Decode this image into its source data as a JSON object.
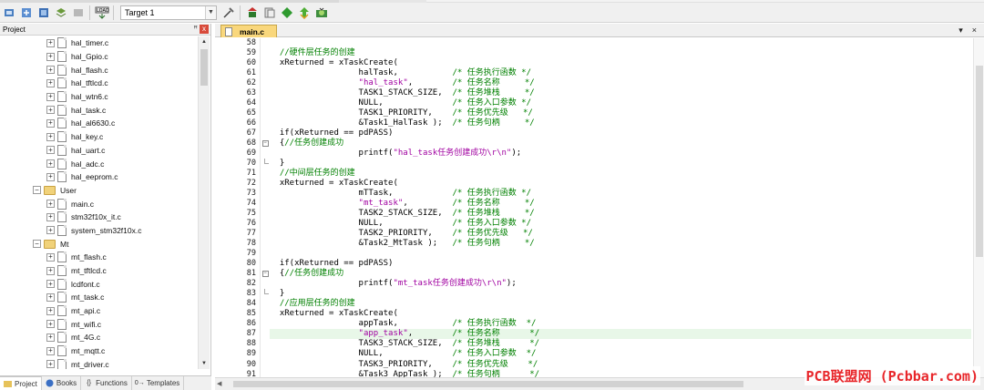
{
  "toolbar": {
    "target": "Target 1",
    "icons": [
      "build-icon",
      "rebuild-icon",
      "batch-build-icon",
      "download-icon",
      "translate-icon",
      "load-icon",
      "options-icon",
      "manage-icon",
      "pack-icon",
      "select-icon",
      "settings-icon",
      "green-diamond-icon",
      "debug-icon"
    ]
  },
  "project_panel": {
    "title": "Project",
    "pin": "ꟸ",
    "close": "x",
    "tree": [
      {
        "type": "file",
        "label": "hal_timer.c"
      },
      {
        "type": "file",
        "label": "hal_Gpio.c"
      },
      {
        "type": "file",
        "label": "hal_flash.c"
      },
      {
        "type": "file",
        "label": "hal_tftlcd.c"
      },
      {
        "type": "file",
        "label": "hal_wtn6.c"
      },
      {
        "type": "file",
        "label": "hal_task.c"
      },
      {
        "type": "file",
        "label": "hal_al6630.c"
      },
      {
        "type": "file",
        "label": "hal_key.c"
      },
      {
        "type": "file",
        "label": "hal_uart.c"
      },
      {
        "type": "file",
        "label": "hal_adc.c"
      },
      {
        "type": "file",
        "label": "hal_eeprom.c"
      },
      {
        "type": "folder",
        "label": "User"
      },
      {
        "type": "file",
        "label": "main.c"
      },
      {
        "type": "file",
        "label": "stm32f10x_it.c"
      },
      {
        "type": "file",
        "label": "system_stm32f10x.c"
      },
      {
        "type": "folder",
        "label": "Mt"
      },
      {
        "type": "file",
        "label": "mt_flash.c"
      },
      {
        "type": "file",
        "label": "mt_tftlcd.c"
      },
      {
        "type": "file",
        "label": "lcdfont.c"
      },
      {
        "type": "file",
        "label": "mt_task.c"
      },
      {
        "type": "file",
        "label": "mt_api.c"
      },
      {
        "type": "file",
        "label": "mt_wifi.c"
      },
      {
        "type": "file",
        "label": "mt_4G.c"
      },
      {
        "type": "file",
        "label": "mt_mqtt.c"
      },
      {
        "type": "file",
        "label": "mt_driver.c"
      }
    ],
    "tabs": [
      {
        "label": "Project",
        "icon": "project-icon"
      },
      {
        "label": "Books",
        "icon": "books-icon"
      },
      {
        "label": "Functions",
        "icon": "functions-icon"
      },
      {
        "label": "Templates",
        "icon": "templates-icon"
      }
    ]
  },
  "editor": {
    "tab": "main.c",
    "tab_controls": [
      "▾",
      "×"
    ],
    "highlight_line": 87,
    "lines": [
      {
        "n": "58",
        "fold": "vl",
        "parts": []
      },
      {
        "n": "59",
        "fold": "vl",
        "parts": [
          {
            "t": "  //硬件层任务的创建",
            "c": "cmt"
          }
        ]
      },
      {
        "n": "60",
        "fold": "vl",
        "parts": [
          {
            "t": "  xReturned = xTaskCreate(",
            "c": "txt"
          }
        ]
      },
      {
        "n": "61",
        "fold": "vl",
        "parts": [
          {
            "t": "                  halTask,           ",
            "c": "txt"
          },
          {
            "t": "/* 任务执行函数 */",
            "c": "cmt"
          }
        ]
      },
      {
        "n": "62",
        "fold": "vl",
        "parts": [
          {
            "t": "                  ",
            "c": "txt"
          },
          {
            "t": "\"hal_task\"",
            "c": "str"
          },
          {
            "t": ",        ",
            "c": "txt"
          },
          {
            "t": "/* 任务名称     */",
            "c": "cmt"
          }
        ]
      },
      {
        "n": "63",
        "fold": "vl",
        "parts": [
          {
            "t": "                  TASK1_STACK_SIZE,  ",
            "c": "txt"
          },
          {
            "t": "/* 任务堆栈     */",
            "c": "cmt"
          }
        ]
      },
      {
        "n": "64",
        "fold": "vl",
        "parts": [
          {
            "t": "                  NULL,              ",
            "c": "txt"
          },
          {
            "t": "/* 任务入口参数 */",
            "c": "cmt"
          }
        ]
      },
      {
        "n": "65",
        "fold": "vl",
        "parts": [
          {
            "t": "                  TASK1_PRIORITY,    ",
            "c": "txt"
          },
          {
            "t": "/* 任务优先级   */",
            "c": "cmt"
          }
        ]
      },
      {
        "n": "66",
        "fold": "vl",
        "parts": [
          {
            "t": "                  &Task1_HalTask );  ",
            "c": "txt"
          },
          {
            "t": "/* 任务句柄     */",
            "c": "cmt"
          }
        ]
      },
      {
        "n": "67",
        "fold": "vl",
        "parts": [
          {
            "t": "  if(xReturned == pdPASS)",
            "c": "txt"
          }
        ]
      },
      {
        "n": "68",
        "fold": "box",
        "parts": [
          {
            "t": "  {",
            "c": "txt"
          },
          {
            "t": "//任务创建成功",
            "c": "cmt"
          }
        ]
      },
      {
        "n": "69",
        "fold": "vl",
        "parts": [
          {
            "t": "                  printf(",
            "c": "txt"
          },
          {
            "t": "\"hal_task任务创建成功\\r\\n\"",
            "c": "str"
          },
          {
            "t": ");",
            "c": "txt"
          }
        ]
      },
      {
        "n": "70",
        "fold": "end",
        "parts": [
          {
            "t": "  }",
            "c": "txt"
          }
        ]
      },
      {
        "n": "71",
        "fold": "vl",
        "parts": [
          {
            "t": "  //中间层任务的创建",
            "c": "cmt"
          }
        ]
      },
      {
        "n": "72",
        "fold": "vl",
        "parts": [
          {
            "t": "  xReturned = xTaskCreate(",
            "c": "txt"
          }
        ]
      },
      {
        "n": "73",
        "fold": "vl",
        "parts": [
          {
            "t": "                  mTTask,            ",
            "c": "txt"
          },
          {
            "t": "/* 任务执行函数 */",
            "c": "cmt"
          }
        ]
      },
      {
        "n": "74",
        "fold": "vl",
        "parts": [
          {
            "t": "                  ",
            "c": "txt"
          },
          {
            "t": "\"mt_task\"",
            "c": "str"
          },
          {
            "t": ",         ",
            "c": "txt"
          },
          {
            "t": "/* 任务名称     */",
            "c": "cmt"
          }
        ]
      },
      {
        "n": "75",
        "fold": "vl",
        "parts": [
          {
            "t": "                  TASK2_STACK_SIZE,  ",
            "c": "txt"
          },
          {
            "t": "/* 任务堆栈     */",
            "c": "cmt"
          }
        ]
      },
      {
        "n": "76",
        "fold": "vl",
        "parts": [
          {
            "t": "                  NULL,              ",
            "c": "txt"
          },
          {
            "t": "/* 任务入口参数 */",
            "c": "cmt"
          }
        ]
      },
      {
        "n": "77",
        "fold": "vl",
        "parts": [
          {
            "t": "                  TASK2_PRIORITY,    ",
            "c": "txt"
          },
          {
            "t": "/* 任务优先级   */",
            "c": "cmt"
          }
        ]
      },
      {
        "n": "78",
        "fold": "vl",
        "parts": [
          {
            "t": "                  &Task2_MtTask );   ",
            "c": "txt"
          },
          {
            "t": "/* 任务句柄     */",
            "c": "cmt"
          }
        ]
      },
      {
        "n": "79",
        "fold": "vl",
        "parts": []
      },
      {
        "n": "80",
        "fold": "vl",
        "parts": [
          {
            "t": "  if(xReturned == pdPASS)",
            "c": "txt"
          }
        ]
      },
      {
        "n": "81",
        "fold": "box",
        "parts": [
          {
            "t": "  {",
            "c": "txt"
          },
          {
            "t": "//任务创建成功",
            "c": "cmt"
          }
        ]
      },
      {
        "n": "82",
        "fold": "vl",
        "parts": [
          {
            "t": "                  printf(",
            "c": "txt"
          },
          {
            "t": "\"mt_task任务创建成功\\r\\n\"",
            "c": "str"
          },
          {
            "t": ");",
            "c": "txt"
          }
        ]
      },
      {
        "n": "83",
        "fold": "end",
        "parts": [
          {
            "t": "  }",
            "c": "txt"
          }
        ]
      },
      {
        "n": "84",
        "fold": "vl",
        "parts": [
          {
            "t": "  //应用层任务的创建",
            "c": "cmt"
          }
        ]
      },
      {
        "n": "85",
        "fold": "vl",
        "parts": [
          {
            "t": "  xReturned = xTaskCreate(",
            "c": "txt"
          }
        ]
      },
      {
        "n": "86",
        "fold": "vl",
        "parts": [
          {
            "t": "                  appTask,           ",
            "c": "txt"
          },
          {
            "t": "/* 任务执行函数  */",
            "c": "cmt"
          }
        ]
      },
      {
        "n": "87",
        "fold": "vl",
        "parts": [
          {
            "t": "                  ",
            "c": "txt"
          },
          {
            "t": "\"app_task\"",
            "c": "str"
          },
          {
            "t": ",        ",
            "c": "txt"
          },
          {
            "t": "/* 任务名称      */",
            "c": "cmt"
          }
        ]
      },
      {
        "n": "88",
        "fold": "vl",
        "parts": [
          {
            "t": "                  TASK3_STACK_SIZE,  ",
            "c": "txt"
          },
          {
            "t": "/* 任务堆栈      */",
            "c": "cmt"
          }
        ]
      },
      {
        "n": "89",
        "fold": "vl",
        "parts": [
          {
            "t": "                  NULL,              ",
            "c": "txt"
          },
          {
            "t": "/* 任务入口参数  */",
            "c": "cmt"
          }
        ]
      },
      {
        "n": "90",
        "fold": "vl",
        "parts": [
          {
            "t": "                  TASK3_PRIORITY,    ",
            "c": "txt"
          },
          {
            "t": "/* 任务优先级    */",
            "c": "cmt"
          }
        ]
      },
      {
        "n": "91",
        "fold": "vl",
        "parts": [
          {
            "t": "                  &Task3_AppTask );  ",
            "c": "txt"
          },
          {
            "t": "/* 任务句柄      */",
            "c": "cmt"
          }
        ]
      }
    ]
  },
  "watermark": "PCB联盟网 (Pcbbar.com)",
  "colors": {
    "comment": "#008000",
    "string": "#a000a0",
    "tab": "#f9d77c",
    "highlight": "#e8f7e8"
  }
}
